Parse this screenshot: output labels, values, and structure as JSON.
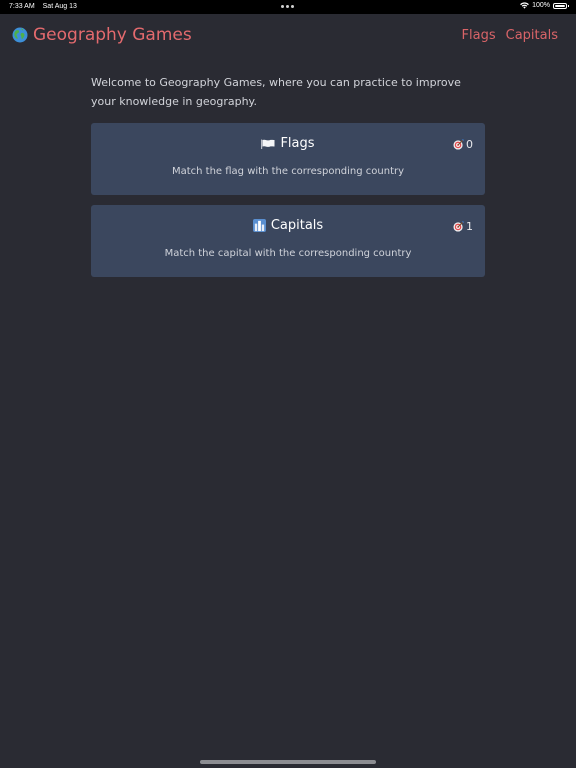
{
  "status_bar": {
    "time": "7:33 AM",
    "date": "Sat Aug 13",
    "battery": "100%",
    "icons": [
      "wifi-icon",
      "battery-icon"
    ]
  },
  "navbar": {
    "brand_title": "Geography Games",
    "brand_icon": "globe-icon",
    "links": [
      "Flags",
      "Capitals"
    ]
  },
  "intro": "Welcome to Geography Games, where you can practice to improve your knowledge in geography.",
  "games": [
    {
      "title": "Flags",
      "icon": "flag-icon",
      "description": "Match the flag with the corresponding country",
      "score": "0",
      "score_icon": "target-icon"
    },
    {
      "title": "Capitals",
      "icon": "city-icon",
      "description": "Match the capital with the corresponding country",
      "score": "1",
      "score_icon": "target-icon"
    }
  ],
  "colors": {
    "background": "#2a2b33",
    "accent": "#e46a6e",
    "card": "#3b475e"
  }
}
